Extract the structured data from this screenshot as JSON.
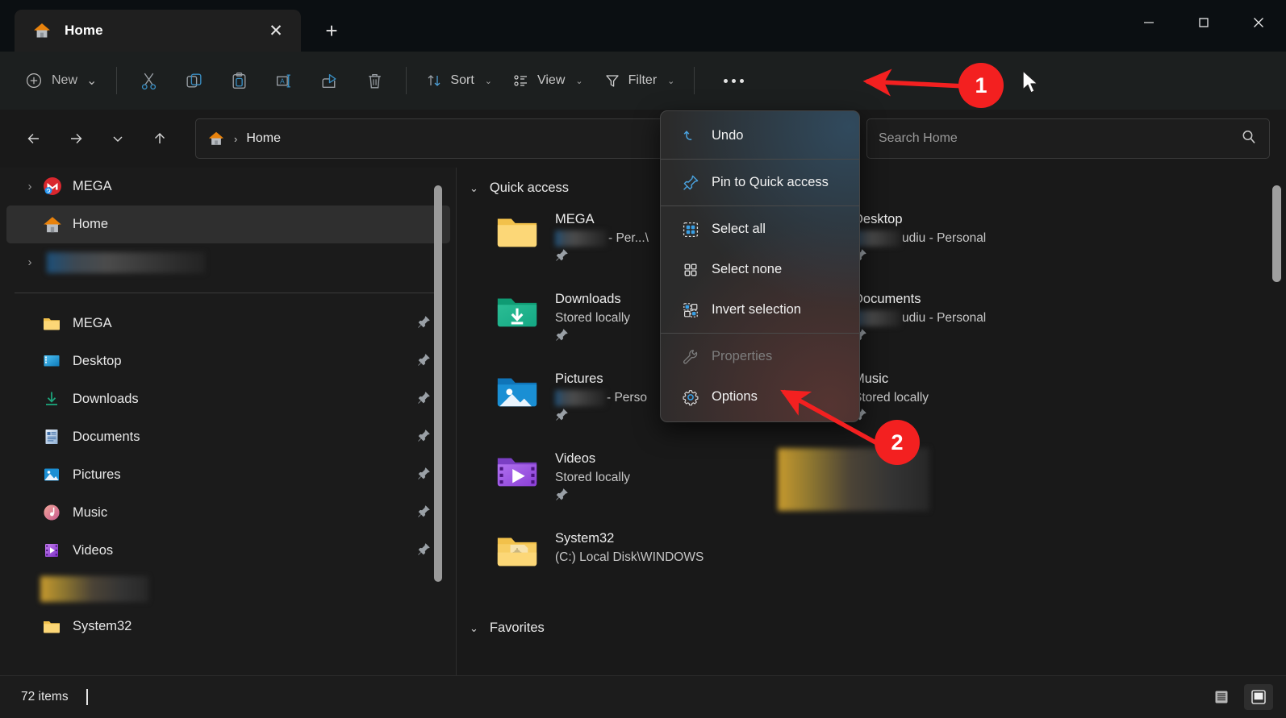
{
  "window": {
    "tab_title": "Home",
    "tab_icon": "home-icon",
    "close_tab_glyph": "✕",
    "new_tab_glyph": "+",
    "controls": {
      "minimize": "minimize-icon",
      "maximize": "maximize-icon",
      "close": "close-icon"
    }
  },
  "toolbar": {
    "new_label": "New",
    "new_chevron": "⌄",
    "icons": [
      "cut-icon",
      "copy-icon",
      "paste-icon",
      "rename-icon",
      "share-icon",
      "delete-icon"
    ],
    "sort_label": "Sort",
    "view_label": "View",
    "filter_label": "Filter",
    "chevron": "⌄",
    "overflow_label": "see-more-button"
  },
  "addressbar": {
    "back": "back-arrow-icon",
    "forward": "forward-arrow-icon",
    "recent": "chevron-down-icon",
    "up": "up-arrow-icon",
    "breadcrumb_icon": "home-icon",
    "breadcrumb_separator": "›",
    "breadcrumb_text": "Home",
    "search_placeholder": "Search Home",
    "search_value": "",
    "search_icon": "search-icon"
  },
  "sidebar": {
    "tree": [
      {
        "label": "MEGA",
        "icon": "mega-icon",
        "chevron": "›",
        "selected": false,
        "blurred": false
      },
      {
        "label": "Home",
        "icon": "home-icon",
        "chevron": "",
        "selected": true,
        "blurred": false
      },
      {
        "label": "",
        "icon": "",
        "chevron": "›",
        "selected": false,
        "blurred": true
      }
    ],
    "pinned": [
      {
        "label": "MEGA",
        "icon": "folder-icon",
        "pinned": true,
        "blurred": false
      },
      {
        "label": "Desktop",
        "icon": "desktop-icon",
        "pinned": true,
        "blurred": false
      },
      {
        "label": "Downloads",
        "icon": "downloads-icon",
        "pinned": true,
        "blurred": false
      },
      {
        "label": "Documents",
        "icon": "documents-icon",
        "pinned": true,
        "blurred": false
      },
      {
        "label": "Pictures",
        "icon": "pictures-icon",
        "pinned": true,
        "blurred": false
      },
      {
        "label": "Music",
        "icon": "music-icon",
        "pinned": true,
        "blurred": false
      },
      {
        "label": "Videos",
        "icon": "videos-icon",
        "pinned": true,
        "blurred": false
      },
      {
        "label": "",
        "icon": "",
        "pinned": false,
        "blurred": true
      },
      {
        "label": "System32",
        "icon": "folder-icon",
        "pinned": false,
        "blurred": false
      }
    ]
  },
  "content": {
    "quick_access": {
      "title": "Quick access",
      "chevron": "⌄"
    },
    "favorites": {
      "title": "Favorites",
      "chevron": "⌄"
    },
    "items": [
      {
        "name": "MEGA",
        "sub_blurred": true,
        "sub": " - Per...\\",
        "icon": "folder-icon",
        "pinned": true
      },
      {
        "name": "Desktop",
        "sub_blurred": true,
        "sub": "udiu - Personal",
        "icon": "desktop-icon",
        "pinned": true
      },
      {
        "name": "Downloads",
        "sub_blurred": false,
        "sub": "Stored locally",
        "icon": "downloads-icon",
        "pinned": true
      },
      {
        "name": "Documents",
        "sub_blurred": true,
        "sub": "udiu - Personal",
        "icon": "documents-icon",
        "pinned": true
      },
      {
        "name": "Pictures",
        "sub_blurred": true,
        "sub": " - Perso",
        "icon": "pictures-icon",
        "pinned": true
      },
      {
        "name": "Music",
        "sub_blurred": false,
        "sub": "Stored locally",
        "icon": "music-icon",
        "pinned": true
      },
      {
        "name": "Videos",
        "sub_blurred": false,
        "sub": "Stored locally",
        "icon": "videos-icon",
        "pinned": true
      },
      {
        "name": "System32",
        "sub_blurred": false,
        "sub": "(C:) Local Disk\\WINDOWS",
        "icon": "folder-system-icon",
        "pinned": false
      }
    ]
  },
  "menu": {
    "items": [
      {
        "label": "Undo",
        "icon": "undo-icon",
        "disabled": false,
        "divider_after": true
      },
      {
        "label": "Pin to Quick access",
        "icon": "pin-icon",
        "disabled": false,
        "divider_after": true
      },
      {
        "label": "Select all",
        "icon": "select-all-icon",
        "disabled": false,
        "divider_after": false
      },
      {
        "label": "Select none",
        "icon": "select-none-icon",
        "disabled": false,
        "divider_after": false
      },
      {
        "label": "Invert selection",
        "icon": "invert-selection-icon",
        "disabled": false,
        "divider_after": true
      },
      {
        "label": "Properties",
        "icon": "wrench-icon",
        "disabled": true,
        "divider_after": false
      },
      {
        "label": "Options",
        "icon": "gear-icon",
        "disabled": false,
        "divider_after": false
      }
    ]
  },
  "statusbar": {
    "items_count": "72 items",
    "view_details_icon": "details-view-icon",
    "view_large_icons_icon": "large-icons-view-icon"
  },
  "annotations": {
    "accent_color": "#f32020",
    "markers": [
      {
        "number": "1",
        "target": "see-more-button"
      },
      {
        "number": "2",
        "target": "options-menu-item"
      }
    ],
    "cursor": "mouse-pointer-icon"
  }
}
